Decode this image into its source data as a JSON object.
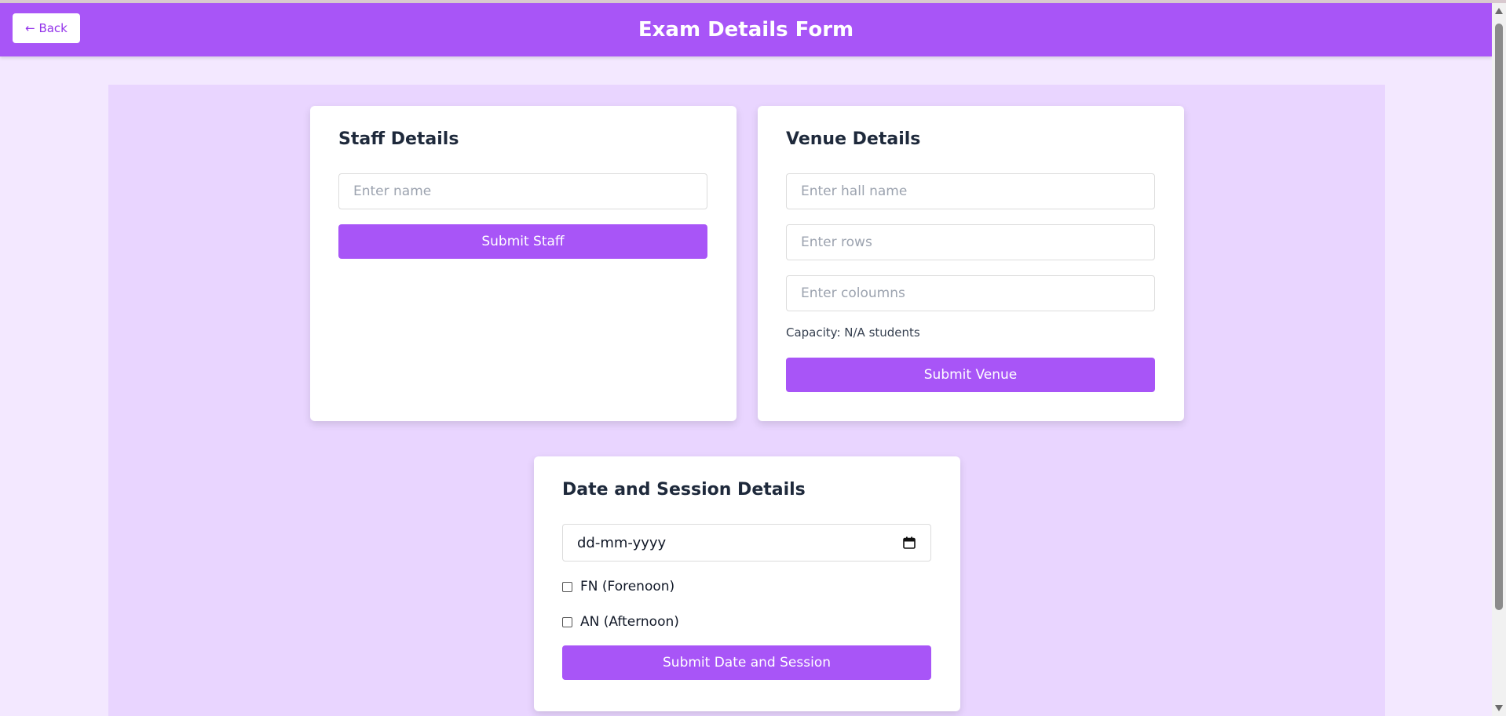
{
  "header": {
    "back_label": "← Back",
    "title": "Exam Details Form"
  },
  "staff": {
    "heading": "Staff Details",
    "name_placeholder": "Enter name",
    "submit_label": "Submit Staff"
  },
  "venue": {
    "heading": "Venue Details",
    "hall_placeholder": "Enter hall name",
    "rows_placeholder": "Enter rows",
    "columns_placeholder": "Enter coloumns",
    "capacity_text": "Capacity: N/A students",
    "submit_label": "Submit Venue"
  },
  "session": {
    "heading": "Date and Session Details",
    "date_value": "dd-mm-yyyy",
    "fn_label": "FN (Forenoon)",
    "fn_checked": false,
    "an_label": "AN (Afternoon)",
    "an_checked": false,
    "submit_label": "Submit Date and Session"
  },
  "colors": {
    "accent": "#a855f7",
    "page_bg": "#f3e8ff",
    "panel_bg": "#e9d5ff"
  },
  "icons": {
    "calendar": "calendar-icon"
  }
}
